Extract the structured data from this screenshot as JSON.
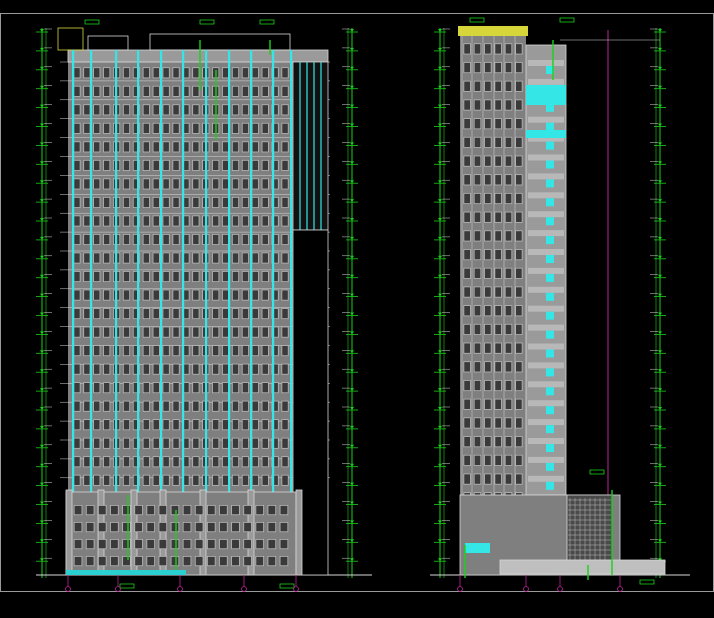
{
  "drawing": {
    "title": "",
    "background": "#000000",
    "colors": {
      "frame": "#9a9a9a",
      "facade": "#7f7f7f",
      "window": "#b8b8b8",
      "window_dark": "#3a3a3a",
      "cyan": "#35e6e6",
      "green": "#19d219",
      "white_line": "#d8d8d8",
      "magenta": "#c0209a",
      "yellow": "#d6d63a",
      "ground": "#2ad0d0"
    },
    "views": [
      {
        "id": "front-elevation",
        "label": ""
      },
      {
        "id": "side-elevation",
        "label": ""
      }
    ]
  }
}
